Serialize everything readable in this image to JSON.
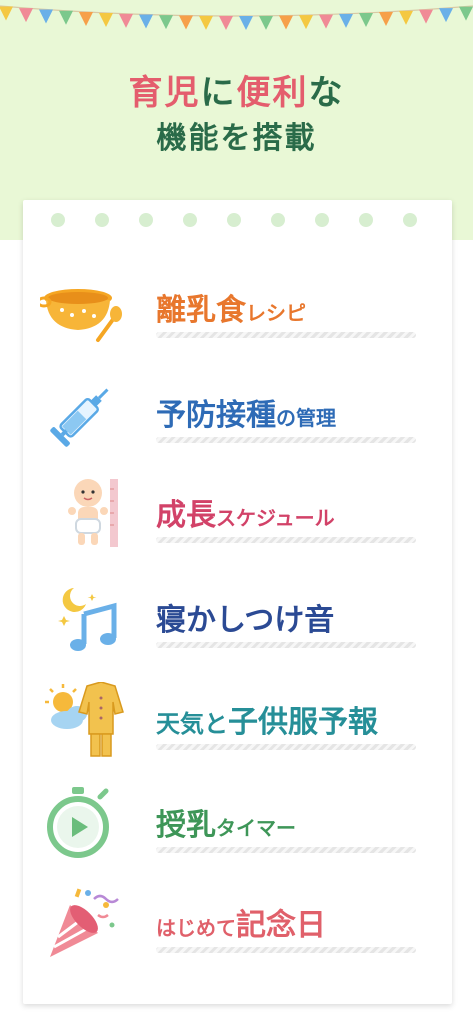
{
  "header": {
    "title_line1": {
      "a": "育児",
      "b": "に",
      "c": "便利",
      "d": "な"
    },
    "title_line2": "機能を搭載"
  },
  "features": [
    {
      "main": "離乳食",
      "sub": "レシピ",
      "icon": "baby-food-bowl-icon",
      "color": "#e8772d"
    },
    {
      "main": "予防接種",
      "sub": "の管理",
      "icon": "syringe-icon",
      "color": "#2e6bb6"
    },
    {
      "main": "成長",
      "sub": "スケジュール",
      "icon": "baby-growth-icon",
      "color": "#d24268"
    },
    {
      "main": "寝かしつけ音",
      "sub": "",
      "icon": "moon-music-icon",
      "color": "#2b4a94"
    },
    {
      "main": "天気と",
      "sub2": "子供服予報",
      "icon": "weather-clothes-icon",
      "color": "#268f98"
    },
    {
      "main": "授乳",
      "sub": "タイマー",
      "icon": "stopwatch-icon",
      "color": "#3e9658"
    },
    {
      "pre": "はじめて",
      "main": "記念日",
      "icon": "party-popper-icon",
      "color": "#e0606a"
    }
  ]
}
